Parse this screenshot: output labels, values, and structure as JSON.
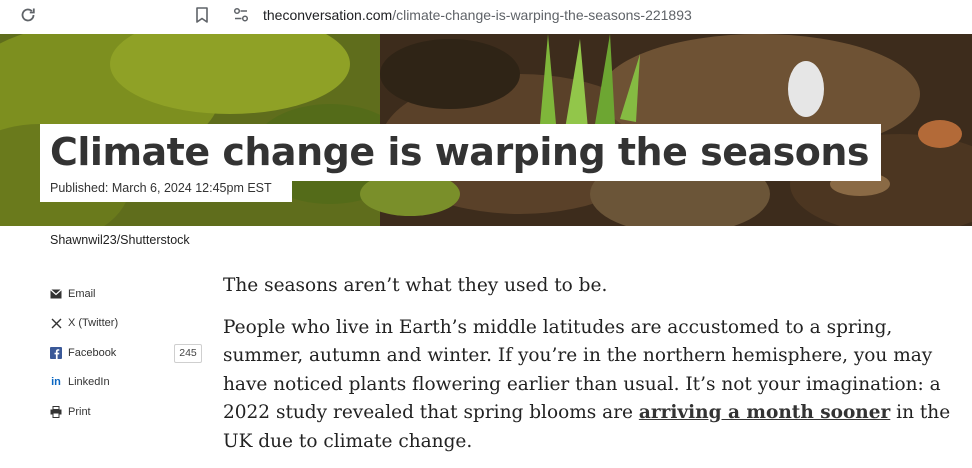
{
  "browser": {
    "url_host": "theconversation.com",
    "url_path": "/climate-change-is-warping-the-seasons-221893"
  },
  "article": {
    "title": "Climate change is warping the seasons",
    "published": "Published: March 6, 2024 12:45pm EST",
    "image_credit": "Shawnwil23/Shutterstock",
    "paragraph1": "The seasons aren’t what they used to be.",
    "paragraph2_part1": "People who live in Earth’s middle latitudes are accustomed to a spring, summer, autumn and winter. If you’re in the northern hemisphere, you may have noticed plants flowering earlier than usual. It’s not your imagination: a 2022 study revealed that spring blooms are ",
    "paragraph2_link": "arriving a month sooner",
    "paragraph2_part2": " in the UK due to climate change."
  },
  "share": {
    "email": "Email",
    "twitter": "X (Twitter)",
    "facebook": "Facebook",
    "facebook_count": "245",
    "linkedin": "LinkedIn",
    "print": "Print"
  },
  "icons": {
    "reload": "reload-icon",
    "bookmark": "bookmark-icon",
    "site_settings": "tune-icon",
    "email": "envelope-icon",
    "twitter": "x-icon",
    "facebook": "facebook-icon",
    "linkedin": "linkedin-icon",
    "print": "printer-icon"
  },
  "colors": {
    "title_text": "#333333",
    "link": "#333333",
    "facebook": "#3b5998",
    "linkedin": "#0a66c2"
  }
}
